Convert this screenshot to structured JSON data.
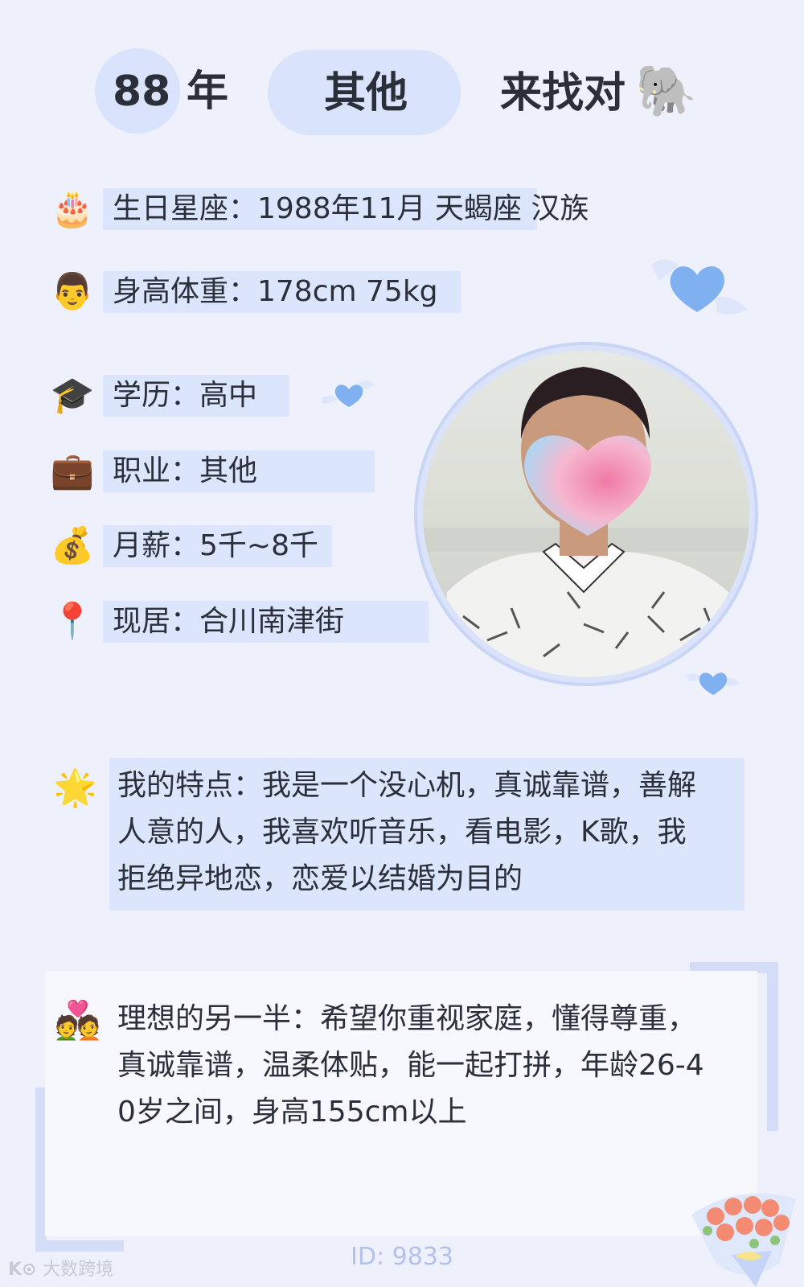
{
  "header": {
    "year": "88",
    "year_suffix": "年",
    "occupation": "其他",
    "slogan": "来找对",
    "slogan_emoji": "🐘"
  },
  "info": {
    "birthday": {
      "icon": "🎂",
      "label": "生日星座：1988年11月 天蝎座 汉族"
    },
    "height_weight": {
      "icon": "👨",
      "label": "身高体重：178cm 75kg"
    },
    "education": {
      "icon": "🎓",
      "label": "学历：高中"
    },
    "job": {
      "icon": "💼",
      "label": "职业：其他"
    },
    "salary": {
      "icon": "💰",
      "label": "月薪：5千~8千"
    },
    "residence": {
      "icon": "📍",
      "label": "现居：合川南津街"
    }
  },
  "bio": {
    "icon": "🌟",
    "lines": [
      "我的特点：我是一个没心机，真诚靠谱，善解",
      "人意的人，我喜欢听音乐，看电影，K歌，我",
      "拒绝异地恋，恋爱以结婚为目的"
    ]
  },
  "ideal": {
    "icon": "💑",
    "lines": [
      "理想的另一半：希望你重视家庭，懂得尊重，",
      "真诚靠谱，温柔体贴，能一起打拼，年龄26-4",
      "0岁之间，身高155cm以上"
    ]
  },
  "footer": {
    "id_text": "ID: 9833",
    "watermark": "大数跨境"
  },
  "colors": {
    "background": "#eef1fc",
    "highlight": "#dbe5fb",
    "accent_heart": "#7fb0f0"
  }
}
